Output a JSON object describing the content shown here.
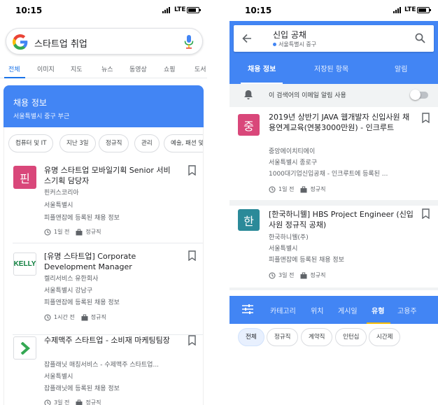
{
  "status_bar": {
    "time": "10:15",
    "network": "LTE"
  },
  "left": {
    "search": {
      "query": "스타트업 취업"
    },
    "tabs": [
      "전체",
      "이미지",
      "지도",
      "뉴스",
      "동영상",
      "쇼핑",
      "도서"
    ],
    "jobs_header": {
      "title": "채용 정보",
      "location": "서울특별시 중구 부근"
    },
    "chips": [
      "컴퓨터 및 IT",
      "지난 3일",
      "정규직",
      "관리",
      "예술, 패션 및"
    ],
    "jobs": [
      {
        "logo_text": "핀",
        "logo_color": "#d9477a",
        "title": "유명 스타트업 모바일기획 Senior 서비스기획 담당자",
        "company": "핀커스코리아",
        "location": "서울특별시",
        "source": "피플앤잡에 등록된 채용 정보",
        "posted": "1일 전",
        "type": "정규직"
      },
      {
        "logo_text": "KELLY",
        "logo_color": "#0a7d3b",
        "title": "[유명 스타트업] Corporate Development Manager",
        "company": "켈리서비스 유한회사",
        "location": "서울특별시 강남구",
        "source": "피플앤잡에 등록된 채용 정보",
        "posted": "1시간 전",
        "type": "정규직"
      },
      {
        "logo_text": "",
        "logo_color": "#34a853",
        "title": "수제맥주 스타트업 - 소비재 마케팅팀장",
        "company": "잡플래닛 매칭서비스 - 수제맥주 스타트업...",
        "location": "서울특별시",
        "source": "잡플래닛에 등록된 채용 정보",
        "posted": "3일 전",
        "type": "정규직"
      }
    ]
  },
  "right": {
    "search": {
      "query": "신입 공채",
      "location": "서울특별시 중구"
    },
    "tabs": [
      "채용 정보",
      "저장된 항목",
      "알림"
    ],
    "alert_text": "이 검색어의 이메일 알림 사용",
    "jobs": [
      {
        "logo_text": "중",
        "logo_color": "#d9477a",
        "title": "2019년 상반기 JAVA 웹개발자 신입사원 채용연계교육(연봉3000만원) - 인크루트",
        "company": "중앙에이치티에이",
        "location": "서울특별시 종로구",
        "source": "1000대기업신입공채 - 인크루트에 등록된 ...",
        "posted": "1일 전",
        "type": "정규직"
      },
      {
        "logo_text": "한",
        "logo_color": "#2b8a99",
        "title": "[한국하니웰] HBS Project Engineer (신입사원 정규직 공채)",
        "company": "한국하니웰(주)",
        "location": "서울특별시",
        "source": "피플앤잡에 등록된 채용 정보",
        "posted": "3일 전",
        "type": "정규직"
      }
    ],
    "bottom_tabs": [
      "카테고리",
      "위치",
      "게시일",
      "유형",
      "고용주"
    ],
    "type_chips": [
      "전체",
      "정규직",
      "계약직",
      "인턴십",
      "시간제"
    ]
  }
}
